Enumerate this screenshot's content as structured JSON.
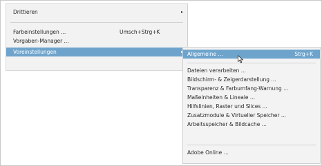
{
  "main_menu": {
    "items": [
      {
        "label": "Drittieren",
        "shortcut": "",
        "arrow": "▸"
      },
      {
        "label": "Farbeinstellungen ...",
        "shortcut": "Umsch+Strg+K",
        "arrow": ""
      },
      {
        "label": "Vorgaben-Manager ...",
        "shortcut": "",
        "arrow": ""
      },
      {
        "label": "Voreinstellungen",
        "shortcut": "",
        "arrow": "▸"
      }
    ]
  },
  "sub_menu": {
    "items": [
      {
        "label": "Allgemeine ...",
        "shortcut": "Strg+K"
      },
      {
        "label": "Dateien verarbeiten ...",
        "shortcut": ""
      },
      {
        "label": "Bildschirm- & Zeigerdarstellung ...",
        "shortcut": ""
      },
      {
        "label": "Transparenz & Farbumfang-Warnung ...",
        "shortcut": ""
      },
      {
        "label": "Maßeinheiten & Lineale ...",
        "shortcut": ""
      },
      {
        "label": "Hilfslinien, Raster und Slices ...",
        "shortcut": ""
      },
      {
        "label": "Zusatzmodule & Virtueller Speicher ...",
        "shortcut": ""
      },
      {
        "label": "Arbeitsspeicher & Bildcache ...",
        "shortcut": ""
      },
      {
        "label": "Adobe Online ...",
        "shortcut": ""
      }
    ]
  },
  "colors": {
    "highlight": "#6ea4cc",
    "menu_bg": "#f2f2f2"
  },
  "icons": {
    "submenu_arrow": "submenu-arrow-icon",
    "pointer": "mouse-pointer-icon"
  }
}
